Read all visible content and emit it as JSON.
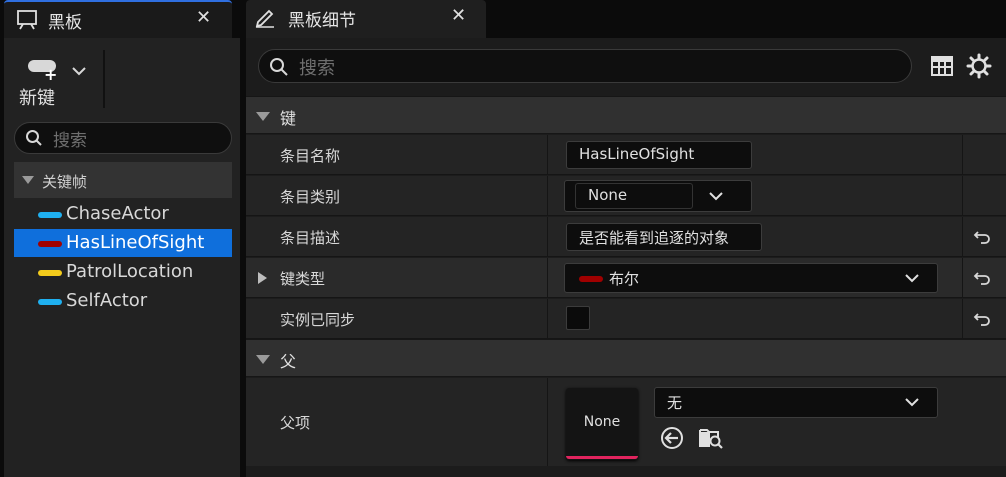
{
  "colors": {
    "accent_blue": "#0f6fdc",
    "cyan_key": "#1fb0f0",
    "red_key": "#a00000",
    "yellow_key": "#f4cc1c",
    "pink_underline": "#e0245e"
  },
  "blackboard_tab": {
    "title": "黑板",
    "close": "✕",
    "icon": "blackboard-icon"
  },
  "toolbar": {
    "new_key_label": "新键",
    "new_key_icon": "new-key-icon"
  },
  "left_search": {
    "placeholder": "搜索"
  },
  "keys": {
    "category": "关键帧",
    "items": [
      {
        "label": "ChaseActor",
        "color": "#1fb0f0",
        "selected": false
      },
      {
        "label": "HasLineOfSight",
        "color": "#a00000",
        "selected": true
      },
      {
        "label": "PatrolLocation",
        "color": "#f4cc1c",
        "selected": false
      },
      {
        "label": "SelfActor",
        "color": "#1fb0f0",
        "selected": false
      }
    ]
  },
  "details_tab": {
    "title": "黑板细节",
    "close": "✕",
    "icon": "pencil-icon"
  },
  "details_search": {
    "placeholder": "搜索"
  },
  "sections": {
    "key": {
      "label": "键",
      "entry_name_label": "条目名称",
      "entry_name_value": "HasLineOfSight",
      "entry_category_label": "条目类别",
      "entry_category_value": "None",
      "entry_description_label": "条目描述",
      "entry_description_value": "是否能看到追逐的对象",
      "key_type_label": "键类型",
      "key_type_value": "布尔",
      "instance_synced_label": "实例已同步",
      "instance_synced_checked": false
    },
    "parent": {
      "label": "父",
      "parent_label": "父项",
      "thumbnail_label": "None",
      "parent_value": "无"
    }
  }
}
